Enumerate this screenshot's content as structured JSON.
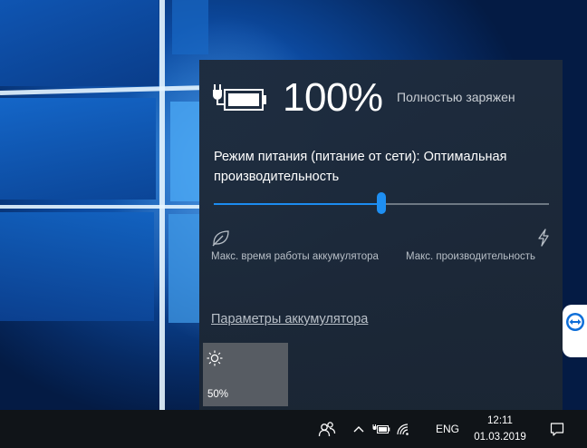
{
  "battery": {
    "percent": "100%",
    "status": "Полностью заряжен",
    "mode_label": "Режим питания (питание от сети): Оптимальная производительность",
    "slider_level": 0.5,
    "slider_min_label": "Макс. время работы аккумулятора",
    "slider_max_label": "Макс. производительность",
    "settings_link": "Параметры аккумулятора",
    "brightness": "50%"
  },
  "taskbar": {
    "language": "ENG",
    "time": "12:11",
    "date": "01.03.2019"
  },
  "icons": [
    "battery-plug-icon",
    "leaf-icon",
    "lightning-icon",
    "sun-icon",
    "teamviewer-icon",
    "people-icon",
    "chevron-up-icon",
    "battery-tray-icon",
    "wifi-icon",
    "notification-icon"
  ],
  "colors": {
    "accent": "#1e8ff2",
    "flyout_bg": "#1e2b3c",
    "taskbar_bg": "#101418",
    "tile_bg": "#575c63"
  }
}
